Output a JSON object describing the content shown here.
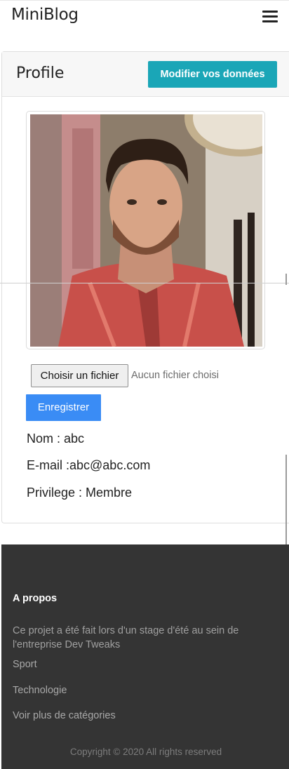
{
  "navbar": {
    "brand": "MiniBlog",
    "menu_icon": "hamburger-menu-icon"
  },
  "profile": {
    "title": "Profile",
    "edit_button": "Modifier vos données",
    "photo_alt": "Photo de profil",
    "file_button": "Choisir un fichier",
    "file_status": "Aucun fichier choisi",
    "save_button": "Enregistrer",
    "name_line": "Nom : abc",
    "email_line": "E-mail :abc@abc.com",
    "privilege_line": "Privilege : Membre"
  },
  "footer": {
    "heading": "A propos",
    "description": "Ce projet a été fait lors d'un stage d'été au sein de l'entreprise Dev Tweaks",
    "links": [
      "Sport",
      "Technologie",
      "Voir plus de catégories"
    ],
    "copyright": "Copyright © 2020 All rights reserved"
  },
  "colors": {
    "edit_button": "#1aa6b7",
    "save_button": "#3a8cf5",
    "footer_bg": "#343434"
  }
}
